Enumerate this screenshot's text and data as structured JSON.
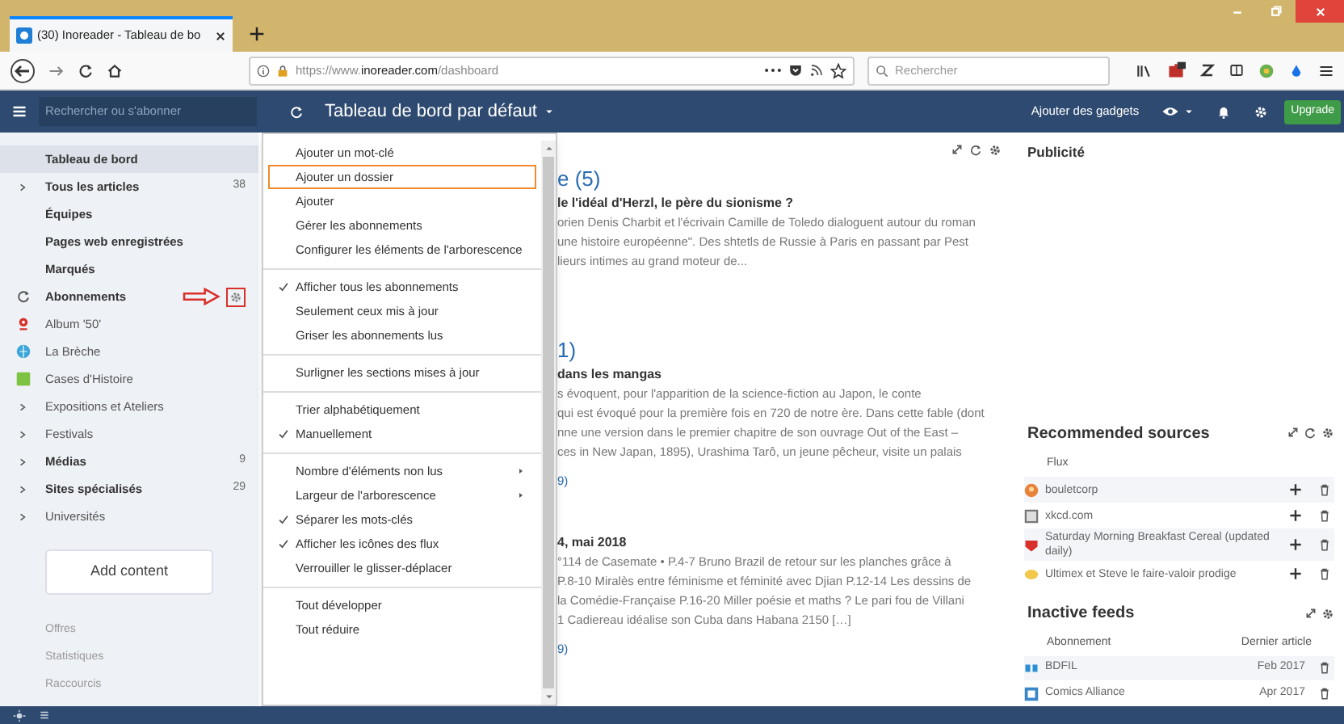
{
  "browser": {
    "tab_title": "(30) Inoreader - Tableau de bo",
    "url_prefix": "https://www.",
    "url_domain": "inoreader.com",
    "url_path": "/dashboard",
    "search_placeholder": "Rechercher"
  },
  "app_bar": {
    "search_placeholder": "Rechercher ou s'abonner",
    "title": "Tableau de bord par défaut",
    "add_gadgets": "Ajouter des gadgets",
    "upgrade": "Upgrade"
  },
  "sidebar": {
    "items": [
      {
        "label": "Tableau de bord",
        "selected": true,
        "bold": true,
        "expandable": false
      },
      {
        "label": "Tous les articles",
        "selected": false,
        "bold": true,
        "expandable": true,
        "count": "38"
      },
      {
        "label": "Équipes",
        "selected": false,
        "bold": true,
        "expandable": false
      },
      {
        "label": "Pages web enregistrées",
        "selected": false,
        "bold": true,
        "expandable": false
      },
      {
        "label": "Marqués",
        "selected": false,
        "bold": true,
        "expandable": false
      },
      {
        "label": "Abonnements",
        "selected": false,
        "bold": true,
        "expandable": false,
        "callout": true
      },
      {
        "label": "Album '50'",
        "selected": false,
        "bold": false,
        "expandable": false
      },
      {
        "label": "La Brèche",
        "selected": false,
        "bold": false,
        "expandable": false
      },
      {
        "label": "Cases d'Histoire",
        "selected": false,
        "bold": false,
        "expandable": false
      },
      {
        "label": "Expositions et Ateliers",
        "selected": false,
        "bold": false,
        "expandable": true
      },
      {
        "label": "Festivals",
        "selected": false,
        "bold": false,
        "expandable": true
      },
      {
        "label": "Médias",
        "selected": false,
        "bold": true,
        "expandable": true,
        "count": "9"
      },
      {
        "label": "Sites spécialisés",
        "selected": false,
        "bold": true,
        "expandable": true,
        "count": "29"
      },
      {
        "label": "Universités",
        "selected": false,
        "bold": false,
        "expandable": true
      }
    ],
    "add_button": "Add content",
    "footer_links": [
      "Offres",
      "Statistiques",
      "Raccourcis"
    ]
  },
  "menu": [
    {
      "kind": "item",
      "label": "Ajouter un mot-clé",
      "checked": false,
      "submenu": false,
      "outlined": false
    },
    {
      "kind": "item",
      "label": "Ajouter un dossier",
      "checked": false,
      "submenu": false,
      "outlined": true
    },
    {
      "kind": "item",
      "label": "Ajouter",
      "checked": false,
      "submenu": false,
      "outlined": false
    },
    {
      "kind": "item",
      "label": "Gérer les abonnements",
      "checked": false,
      "submenu": false,
      "outlined": false
    },
    {
      "kind": "item",
      "label": "Configurer les éléments de l'arborescence",
      "checked": false,
      "submenu": false,
      "outlined": false
    },
    {
      "kind": "divider"
    },
    {
      "kind": "item",
      "label": "Afficher tous les abonnements",
      "checked": true,
      "submenu": false,
      "outlined": false
    },
    {
      "kind": "item",
      "label": "Seulement ceux mis à jour",
      "checked": false,
      "submenu": false,
      "outlined": false
    },
    {
      "kind": "item",
      "label": "Griser les abonnements lus",
      "checked": false,
      "submenu": false,
      "outlined": false
    },
    {
      "kind": "divider"
    },
    {
      "kind": "item",
      "label": "Surligner les sections mises à jour",
      "checked": false,
      "submenu": false,
      "outlined": false
    },
    {
      "kind": "divider"
    },
    {
      "kind": "item",
      "label": "Trier alphabétiquement",
      "checked": false,
      "submenu": false,
      "outlined": false
    },
    {
      "kind": "item",
      "label": "Manuellement",
      "checked": true,
      "submenu": false,
      "outlined": false
    },
    {
      "kind": "divider"
    },
    {
      "kind": "item",
      "label": "Nombre d'éléments non lus",
      "checked": false,
      "submenu": true,
      "outlined": false
    },
    {
      "kind": "item",
      "label": "Largeur de l'arborescence",
      "checked": false,
      "submenu": true,
      "outlined": false
    },
    {
      "kind": "item",
      "label": "Séparer les mots-clés",
      "checked": true,
      "submenu": false,
      "outlined": false
    },
    {
      "kind": "item",
      "label": "Afficher les icônes des flux",
      "checked": true,
      "submenu": false,
      "outlined": false
    },
    {
      "kind": "item",
      "label": "Verrouiller le glisser-déplacer",
      "checked": false,
      "submenu": false,
      "outlined": false
    },
    {
      "kind": "divider"
    },
    {
      "kind": "item",
      "label": "Tout développer",
      "checked": false,
      "submenu": false,
      "outlined": false
    },
    {
      "kind": "item",
      "label": "Tout réduire",
      "checked": false,
      "submenu": false,
      "outlined": false
    }
  ],
  "articles": [
    {
      "title": "e (5)",
      "headline": "le l'idéal d'Herzl, le père du sionisme ?",
      "lines": [
        "orien Denis Charbit et l'écrivain Camille de Toledo dialoguent autour du roman",
        "une histoire européenne\". Des shtetls de Russie à Paris en passant par Pest",
        "lieurs intimes au grand moteur de..."
      ]
    },
    {
      "title": "1)",
      "headline": "dans les mangas",
      "lines": [
        "s évoquent, pour l'apparition de la science-fiction au Japon, le conte",
        "qui est évoqué pour la première fois en 720 de notre ère. Dans cette fable (dont",
        "nne une version dans le premier chapitre de son ouvrage Out of the East –",
        "ces in New Japan, 1895), Urashima Tarô, un jeune pêcheur, visite un palais"
      ],
      "more": "9)"
    },
    {
      "headline": "4, mai 2018",
      "lines": [
        "°114 de Casemate • P.4-7 Bruno Brazil de retour sur les planches grâce à",
        "P.8-10 Miralès entre féminisme et féminité avec Djian P.12-14 Les dessins de",
        "la Comédie-Française P.16-20 Miller poésie et maths ? Le pari fou de Villani",
        "1 Cadiereau idéalise son Cuba dans Habana 2150 […]"
      ],
      "more": "9)"
    }
  ],
  "ad": {
    "title": "Publicité"
  },
  "recommended": {
    "title": "Recommended sources",
    "column": "Flux",
    "rows": [
      {
        "name": "bouletcorp"
      },
      {
        "name": "xkcd.com"
      },
      {
        "name": "Saturday Morning Breakfast Cereal (updated daily)"
      },
      {
        "name": "Ultimex et Steve le faire-valoir prodige"
      }
    ]
  },
  "inactive": {
    "title": "Inactive feeds",
    "columns": [
      "Abonnement",
      "Dernier article"
    ],
    "rows": [
      {
        "name": "BDFIL",
        "date": "Feb 2017"
      },
      {
        "name": "Comics Alliance",
        "date": "Apr 2017"
      }
    ]
  }
}
